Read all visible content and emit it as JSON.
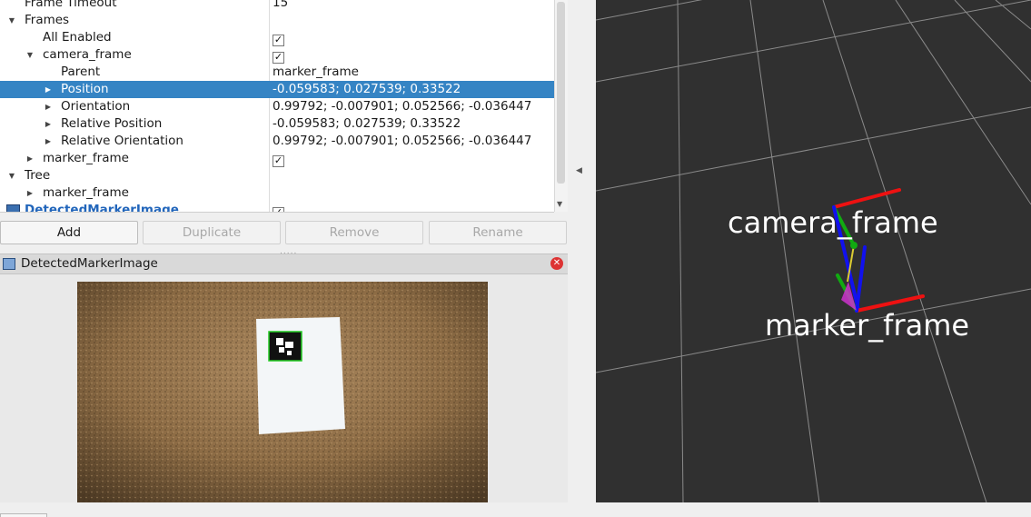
{
  "tree": {
    "rows": [
      {
        "label": "Frame Timeout",
        "value": "15",
        "depth": 0,
        "arrow": "",
        "check": false
      },
      {
        "label": "Frames",
        "value": "",
        "depth": 0,
        "arrow": "down",
        "check": false
      },
      {
        "label": "All Enabled",
        "value": "",
        "depth": 1,
        "arrow": "",
        "check": true
      },
      {
        "label": "camera_frame",
        "value": "",
        "depth": 1,
        "arrow": "down",
        "check": true
      },
      {
        "label": "Parent",
        "value": "marker_frame",
        "depth": 2,
        "arrow": "",
        "check": false
      },
      {
        "label": "Position",
        "value": "-0.059583; 0.027539; 0.33522",
        "depth": 2,
        "arrow": "right",
        "check": false,
        "selected": true
      },
      {
        "label": "Orientation",
        "value": "0.99792; -0.007901; 0.052566; -0.036447",
        "depth": 2,
        "arrow": "right",
        "check": false
      },
      {
        "label": "Relative Position",
        "value": "-0.059583; 0.027539; 0.33522",
        "depth": 2,
        "arrow": "right",
        "check": false
      },
      {
        "label": "Relative Orientation",
        "value": "0.99792; -0.007901; 0.052566; -0.036447",
        "depth": 2,
        "arrow": "right",
        "check": false
      },
      {
        "label": "marker_frame",
        "value": "",
        "depth": 1,
        "arrow": "right",
        "check": true
      },
      {
        "label": "Tree",
        "value": "",
        "depth": 0,
        "arrow": "down",
        "check": false
      },
      {
        "label": "marker_frame",
        "value": "",
        "depth": 1,
        "arrow": "right",
        "check": false
      },
      {
        "label": "DetectedMarkerImage",
        "value": "",
        "depth": 0,
        "arrow": "",
        "check": true,
        "icon": "image-display-icon",
        "link": true
      }
    ]
  },
  "buttons": {
    "add": "Add",
    "duplicate": "Duplicate",
    "remove": "Remove",
    "rename": "Rename"
  },
  "image_panel": {
    "title": "DetectedMarkerImage",
    "close_icon": "close-icon"
  },
  "viewport": {
    "frames": [
      {
        "name": "camera_frame"
      },
      {
        "name": "marker_frame"
      }
    ],
    "axis_colors": {
      "x": "#ee1111",
      "y": "#11aa11",
      "z": "#1111ee"
    },
    "background": "#303030",
    "grid_color": "#9a9a9a"
  },
  "icons": {
    "expanded": "chevron-down-icon",
    "collapsed": "chevron-right-icon",
    "check": "checkbox-checked-icon",
    "collapse_right_panel": "chevron-left-icon"
  }
}
